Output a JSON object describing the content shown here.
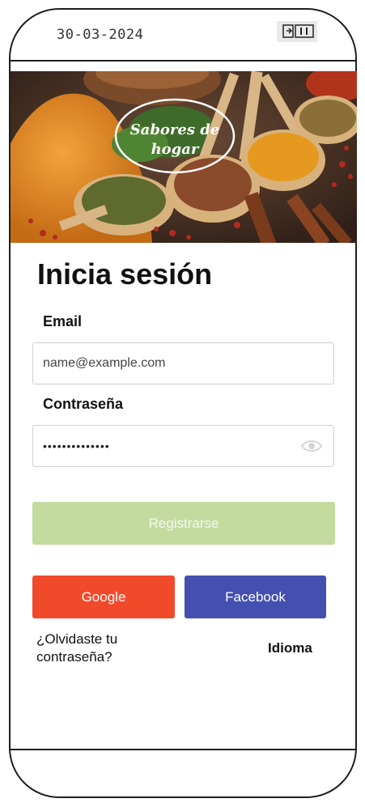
{
  "status": {
    "date": "30-03-2024",
    "icon": "battery-switch-icon"
  },
  "hero": {
    "logo_line1": "Sabores de",
    "logo_line2": "hogar",
    "image": "spices-photo"
  },
  "login": {
    "title": "Inicia sesión",
    "email_label": "Email",
    "email_placeholder": "name@example.com",
    "password_label": "Contraseña",
    "password_value": "••••••••••••••",
    "register_button": "Registrarse",
    "google_button": "Google",
    "facebook_button": "Facebook",
    "forgot_password": "¿Olvidaste tu contraseña?",
    "language_link": "Idioma"
  },
  "colors": {
    "register": "#c4dba0",
    "google": "#f04a2a",
    "facebook": "#4350b0"
  }
}
